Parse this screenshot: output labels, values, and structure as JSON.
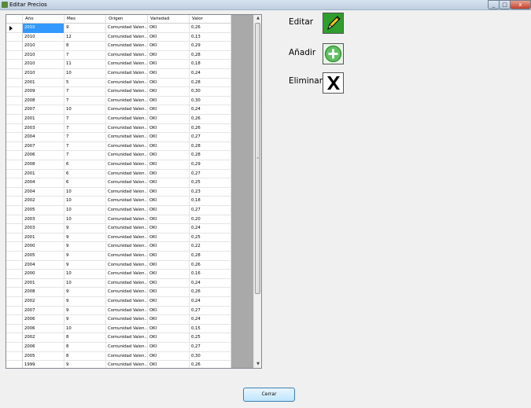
{
  "window": {
    "title": "Editar Precios",
    "min_glyph": "_",
    "max_glyph": "□",
    "close_glyph": "x"
  },
  "grid": {
    "columns": [
      "Año",
      "Mes",
      "Origen",
      "Variedad",
      "Valor"
    ],
    "rows": [
      [
        "2010",
        "9",
        "Comunidad Valen...",
        "OKI",
        "0,26"
      ],
      [
        "2010",
        "12",
        "Comunidad Valen...",
        "OKI",
        "0,13"
      ],
      [
        "2010",
        "8",
        "Comunidad Valen...",
        "OKI",
        "0,29"
      ],
      [
        "2010",
        "7",
        "Comunidad Valen...",
        "OKI",
        "0,28"
      ],
      [
        "2010",
        "11",
        "Comunidad Valen...",
        "OKI",
        "0,18"
      ],
      [
        "2010",
        "10",
        "Comunidad Valen...",
        "OKI",
        "0,24"
      ],
      [
        "2001",
        "5",
        "Comunidad Valen...",
        "OKI",
        "0,28"
      ],
      [
        "2009",
        "7",
        "Comunidad Valen...",
        "OKI",
        "0,30"
      ],
      [
        "2008",
        "7",
        "Comunidad Valen...",
        "OKI",
        "0,30"
      ],
      [
        "2007",
        "10",
        "Comunidad Valen...",
        "OKI",
        "0,24"
      ],
      [
        "2001",
        "7",
        "Comunidad Valen...",
        "OKI",
        "0,26"
      ],
      [
        "2003",
        "7",
        "Comunidad Valen...",
        "OKI",
        "0,26"
      ],
      [
        "2004",
        "7",
        "Comunidad Valen...",
        "OKI",
        "0,27"
      ],
      [
        "2007",
        "7",
        "Comunidad Valen...",
        "OKI",
        "0,28"
      ],
      [
        "2006",
        "7",
        "Comunidad Valen...",
        "OKI",
        "0,28"
      ],
      [
        "2008",
        "6",
        "Comunidad Valen...",
        "OKI",
        "0,29"
      ],
      [
        "2001",
        "6",
        "Comunidad Valen...",
        "OKI",
        "0,27"
      ],
      [
        "2004",
        "6",
        "Comunidad Valen...",
        "OKI",
        "0,25"
      ],
      [
        "2004",
        "10",
        "Comunidad Valen...",
        "OKI",
        "0,23"
      ],
      [
        "2002",
        "10",
        "Comunidad Valen...",
        "OKI",
        "0,18"
      ],
      [
        "2005",
        "10",
        "Comunidad Valen...",
        "OKI",
        "0,27"
      ],
      [
        "2003",
        "10",
        "Comunidad Valen...",
        "OKI",
        "0,20"
      ],
      [
        "2003",
        "9",
        "Comunidad Valen...",
        "OKI",
        "0,24"
      ],
      [
        "2001",
        "9",
        "Comunidad Valen...",
        "OKI",
        "0,25"
      ],
      [
        "2000",
        "9",
        "Comunidad Valen...",
        "OKI",
        "0,22"
      ],
      [
        "2005",
        "9",
        "Comunidad Valen...",
        "OKI",
        "0,28"
      ],
      [
        "2004",
        "9",
        "Comunidad Valen...",
        "OKI",
        "0,26"
      ],
      [
        "2000",
        "10",
        "Comunidad Valen...",
        "OKI",
        "0,16"
      ],
      [
        "2001",
        "10",
        "Comunidad Valen...",
        "OKI",
        "0,24"
      ],
      [
        "2008",
        "9",
        "Comunidad Valen...",
        "OKI",
        "0,26"
      ],
      [
        "2002",
        "9",
        "Comunidad Valen...",
        "OKI",
        "0,24"
      ],
      [
        "2007",
        "9",
        "Comunidad Valen...",
        "OKI",
        "0,27"
      ],
      [
        "2006",
        "9",
        "Comunidad Valen...",
        "OKI",
        "0,24"
      ],
      [
        "2006",
        "10",
        "Comunidad Valen...",
        "OKI",
        "0,15"
      ],
      [
        "2002",
        "8",
        "Comunidad Valen...",
        "OKI",
        "0,25"
      ],
      [
        "2006",
        "8",
        "Comunidad Valen...",
        "OKI",
        "0,27"
      ],
      [
        "2005",
        "8",
        "Comunidad Valen...",
        "OKI",
        "0,30"
      ],
      [
        "1999",
        "9",
        "Comunidad Valen...",
        "OKI",
        "0,26"
      ]
    ]
  },
  "actions": {
    "edit_label": "Editar",
    "add_label": "Añadir",
    "delete_label": "Eliminar"
  },
  "footer": {
    "close_label": "Cerrar"
  },
  "colors": {
    "selection": "#3399ff",
    "edit_bg": "#2e9e2e",
    "add_bg": "#5fc05f",
    "delete_bg": "#ffffff"
  }
}
